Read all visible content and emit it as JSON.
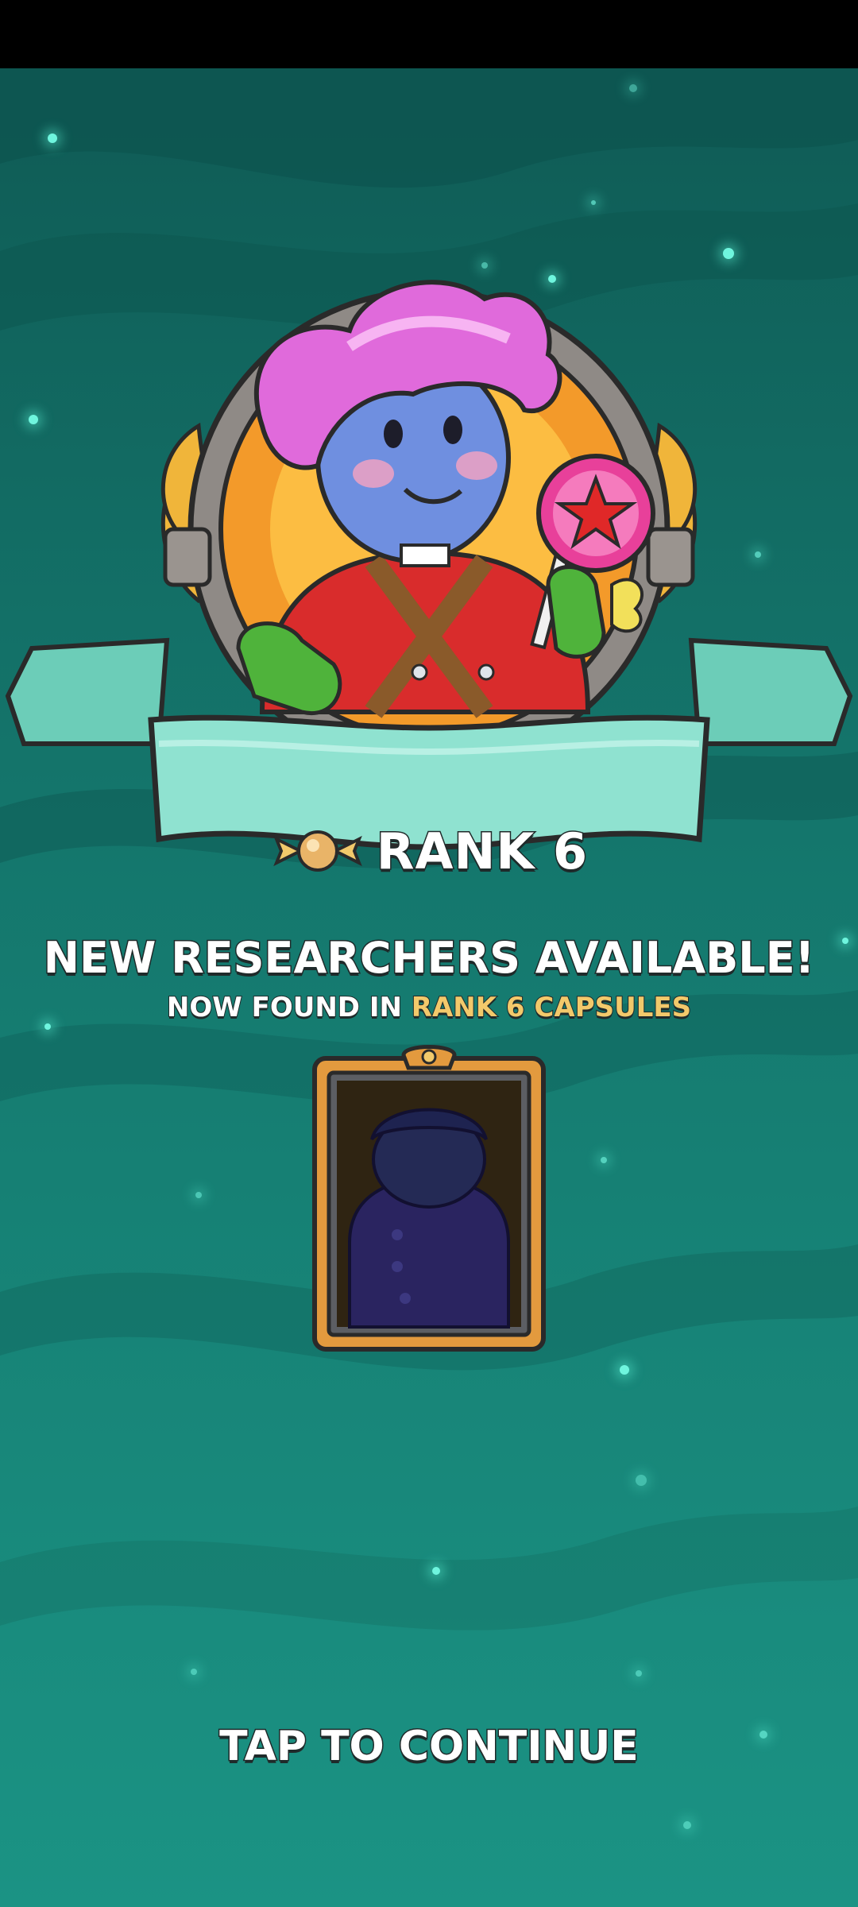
{
  "rank": {
    "label": "RANK 6",
    "icon": "candy-icon"
  },
  "announcement": {
    "headline": "NEW RESEARCHERS AVAILABLE!",
    "subline_prefix": "NOW FOUND IN ",
    "subline_highlight": "RANK 6 CAPSULES"
  },
  "researcher_card": {
    "state": "locked-silhouette"
  },
  "continue_prompt": "TAP TO CONTINUE",
  "colors": {
    "background_top": "#0f5b55",
    "background_bottom": "#1b9384",
    "ribbon": "#7fd9c6",
    "highlight_text": "#f2c96b",
    "card_frame": "#e39a3e"
  }
}
